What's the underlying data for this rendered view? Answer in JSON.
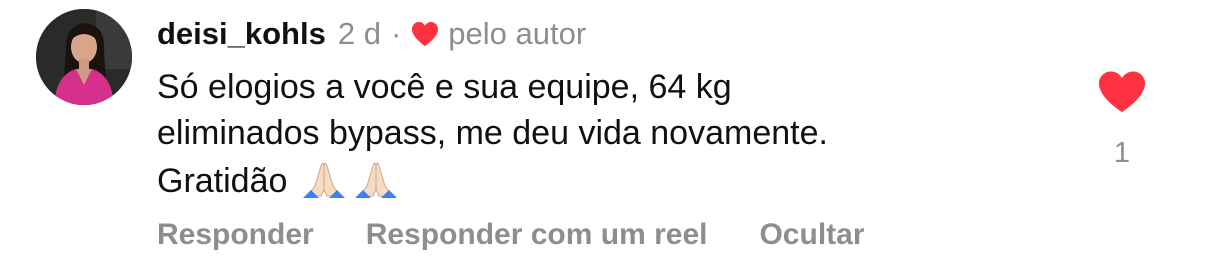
{
  "comment": {
    "username": "deisi_kohls",
    "time": "2 d",
    "separator": "·",
    "liked_by_author_label": "pelo autor",
    "text_line1": "Só elogios a você e sua equipe, 64 kg",
    "text_line2": "eliminados bypass, me deu vida novamente.",
    "text_line3": "Gratidão",
    "emojis": [
      "folded-hands-emoji",
      "folded-hands-emoji"
    ],
    "like_count": "1",
    "liked": true
  },
  "actions": {
    "reply": "Responder",
    "reply_with_reel": "Responder com um reel",
    "hide": "Ocultar"
  },
  "colors": {
    "heart_red": "#ff3040",
    "secondary_text": "#8e8e8e",
    "primary_text": "#111111"
  }
}
